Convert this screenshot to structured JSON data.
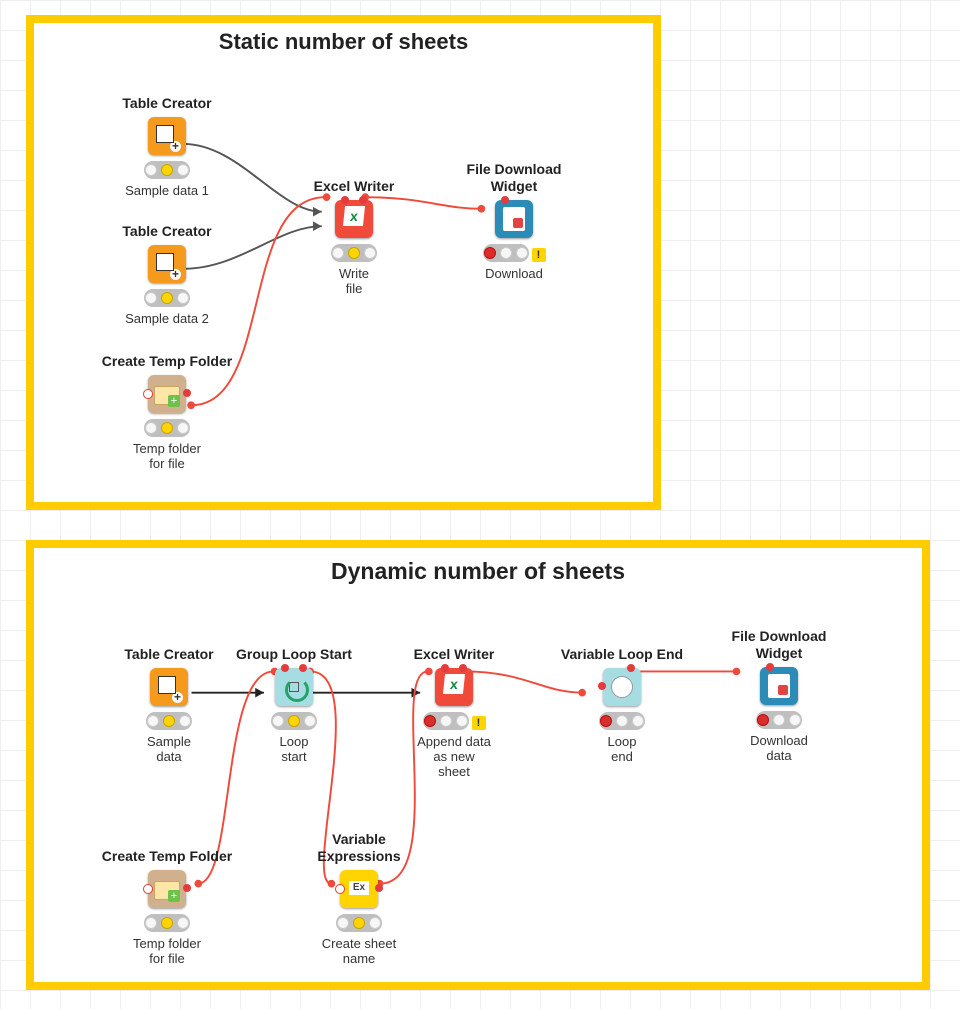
{
  "annotations": {
    "a1": {
      "title": "Static number of sheets"
    },
    "a2": {
      "title": "Dynamic number of sheets"
    }
  },
  "nodes": {
    "s_tc1": {
      "name": "Table Creator",
      "caption": "Sample data 1"
    },
    "s_tc2": {
      "name": "Table Creator",
      "caption": "Sample data 2"
    },
    "s_tmp": {
      "name": "Create Temp Folder",
      "caption": "Temp folder\nfor file"
    },
    "s_xw": {
      "name": "Excel Writer",
      "caption": "Write\nfile"
    },
    "s_dl": {
      "name": "File Download\nWidget",
      "caption": "Download"
    },
    "d_tc": {
      "name": "Table Creator",
      "caption": "Sample\ndata"
    },
    "d_gls": {
      "name": "Group Loop Start",
      "caption": "Loop\nstart"
    },
    "d_xw": {
      "name": "Excel Writer",
      "caption": "Append data\nas new\nsheet"
    },
    "d_vle": {
      "name": "Variable Loop End",
      "caption": "Loop\nend"
    },
    "d_dl": {
      "name": "File Download\nWidget",
      "caption": "Download\ndata"
    },
    "d_tmp": {
      "name": "Create Temp Folder",
      "caption": "Temp folder\nfor file"
    },
    "d_vex": {
      "name": "Variable\nExpressions",
      "caption": "Create sheet\nname"
    }
  },
  "icons": {
    "table": "table-creator-icon",
    "excel": "excel-writer-icon",
    "download": "file-download-icon",
    "folder": "folder-icon",
    "loopstart": "loop-start-icon",
    "loopend": "loop-end-icon",
    "varexpr": "variable-expressions-icon"
  },
  "status": {
    "idle_yellow": "idle",
    "red_warn": "configured-warning",
    "red": "configured"
  }
}
